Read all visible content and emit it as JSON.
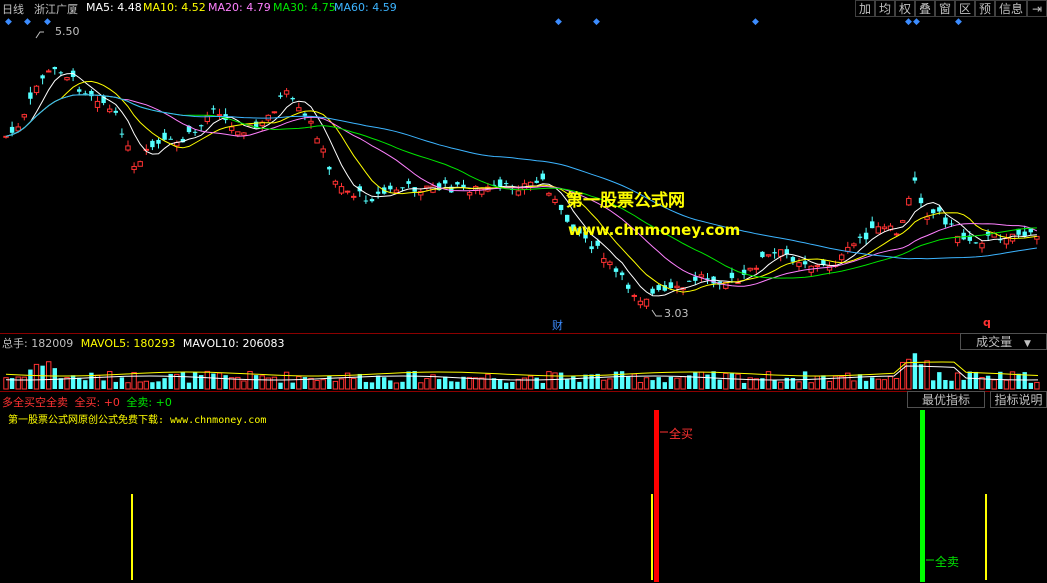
{
  "header": {
    "period": "日线",
    "stock_name": "浙江广厦",
    "ma5": "MA5: 4.48",
    "ma10": "MA10: 4.52",
    "ma20": "MA20: 4.79",
    "ma30": "MA30: 4.75",
    "ma60": "MA60: 4.59"
  },
  "toolbar": [
    "加",
    "均",
    "权",
    "叠",
    "窗",
    "区",
    "预",
    "信息",
    "⇥"
  ],
  "price_panel": {
    "high_label": "5.50",
    "low_label": "3.03",
    "finance_marker": "财",
    "q_marker": "q",
    "watermark_cn": "第一股票公式网",
    "watermark_url": "www.chnmoney.com"
  },
  "volume_panel": {
    "total": "总手: 182009",
    "mavol5": "MAVOL5: 180293",
    "mavol10": "MAVOL10: 206083",
    "type_button": "成交量"
  },
  "indicator_panel": {
    "title": "多全买空全卖",
    "buy_label": "全买: +0",
    "sell_label": "全卖: +0",
    "best_button": "最优指标",
    "help_button": "指标说明",
    "ad_text": "第一股票公式网原创公式免费下载: www.chnmoney.com",
    "buy_marker": "全买",
    "sell_marker": "全卖"
  },
  "colors": {
    "up": "#ff3232",
    "down": "#54ffff",
    "ma5": "#ffffff",
    "ma10": "#ffff00",
    "ma20": "#ff80ff",
    "ma30": "#00e600",
    "ma60": "#3cb4ff"
  }
}
